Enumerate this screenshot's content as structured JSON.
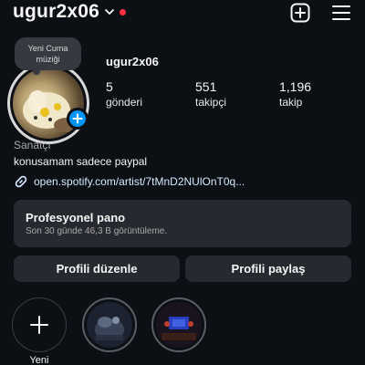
{
  "header": {
    "username": "ugur2x06",
    "icons": {
      "create": "plus-square-icon",
      "menu": "hamburger-menu-icon",
      "switch": "chevron-down-icon"
    },
    "notification_color": "#ff3040"
  },
  "note": {
    "line1": "Yeni Cuma",
    "line2": "müziği"
  },
  "profile": {
    "name": "ugur2x06",
    "stats": [
      {
        "value": "5",
        "label": "gönderi"
      },
      {
        "value": "551",
        "label": "takipçi"
      },
      {
        "value": "1,196",
        "label": "takip"
      }
    ],
    "category": "Sanatçı",
    "bio": "konusamam sadece paypal",
    "link": "open.spotify.com/artist/7tMnD2NUlOnT0q..."
  },
  "dashboard": {
    "title": "Profesyonel pano",
    "subtitle": "Son 30 günde 46,3 B görüntüleme."
  },
  "actions": {
    "edit": "Profili düzenle",
    "share": "Profili paylaş"
  },
  "highlights": {
    "new_label": "Yeni"
  },
  "colors": {
    "accent": "#0095f6",
    "background": "#0c1014",
    "card": "#262a30"
  }
}
